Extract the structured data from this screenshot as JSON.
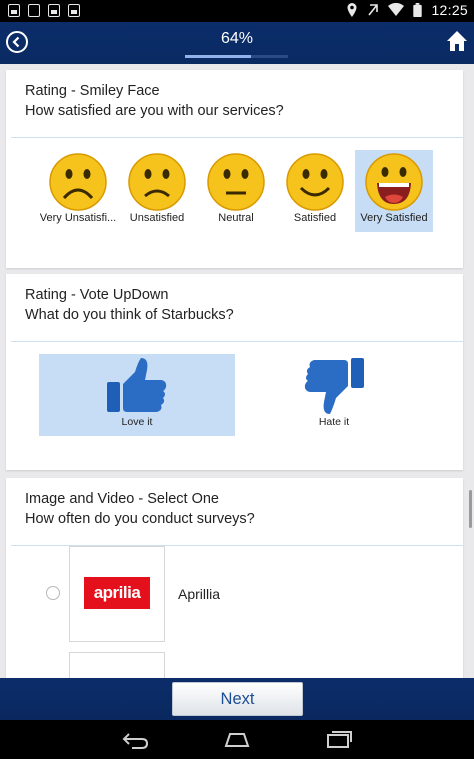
{
  "status_bar": {
    "time": "12:25",
    "left_icons": [
      "gallery-notification-icon",
      "download-notification-icon",
      "sd-card-notification-icon",
      "photo-notification-icon"
    ],
    "right_icons": [
      "location-icon",
      "data-transfer-icon",
      "wifi-icon",
      "battery-icon"
    ]
  },
  "header": {
    "progress_label": "64%",
    "progress": 0.64,
    "back_icon": "circle-chevron-left-icon",
    "home_icon": "home-icon"
  },
  "questions": [
    {
      "title": "Rating - Smiley Face",
      "prompt": "How satisfied are you with our services?",
      "options": [
        {
          "label": "Very Unsatisfi...",
          "icon": "very-unsatisfied-smiley-icon",
          "selected": false
        },
        {
          "label": "Unsatisfied",
          "icon": "unsatisfied-smiley-icon",
          "selected": false
        },
        {
          "label": "Neutral",
          "icon": "neutral-smiley-icon",
          "selected": false
        },
        {
          "label": "Satisfied",
          "icon": "satisfied-smiley-icon",
          "selected": false
        },
        {
          "label": "Very Satisfied",
          "icon": "very-satisfied-smiley-icon",
          "selected": true
        }
      ]
    },
    {
      "title": "Rating - Vote UpDown",
      "prompt": "What do you think of Starbucks?",
      "options": [
        {
          "label": "Love it",
          "icon": "thumbs-up-icon",
          "selected": true
        },
        {
          "label": "Hate it",
          "icon": "thumbs-down-icon",
          "selected": false
        }
      ]
    },
    {
      "title": "Image and Video - Select One",
      "prompt": "How often do you conduct surveys?",
      "options": [
        {
          "label": "Aprillia",
          "logo_text": "aprilia",
          "selected": false
        }
      ]
    }
  ],
  "footer": {
    "next_label": "Next"
  },
  "nav_bar": {
    "icons": [
      "back-icon",
      "home-icon",
      "recent-apps-icon"
    ]
  },
  "colors": {
    "header_bg": "#0b2d6a",
    "selected_bg": "#c7dcf5",
    "thumb_blue": "#2b6cc4",
    "smiley_yellow": "#f6c21c",
    "logo_red": "#e4111c"
  }
}
